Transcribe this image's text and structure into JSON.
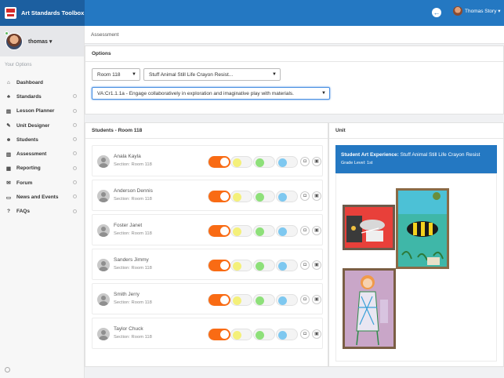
{
  "app": {
    "title": "Art Standards Toolbox"
  },
  "topbar": {
    "user_name": "Thomas Story",
    "user_caret": "▾",
    "back_glyph": "←"
  },
  "sidebar": {
    "profile_name": "thomas ▾",
    "section_label": "Your Options",
    "items": [
      {
        "label": "Dashboard",
        "icon": "⌂"
      },
      {
        "label": "Standards",
        "icon": "♣"
      },
      {
        "label": "Lesson Planner",
        "icon": "▤"
      },
      {
        "label": "Unit Designer",
        "icon": "✎"
      },
      {
        "label": "Students",
        "icon": "☻"
      },
      {
        "label": "Assessment",
        "icon": "▥"
      },
      {
        "label": "Reporting",
        "icon": "▦"
      },
      {
        "label": "Forum",
        "icon": "✉"
      },
      {
        "label": "News and Events",
        "icon": "▭"
      },
      {
        "label": "FAQs",
        "icon": "?"
      }
    ]
  },
  "breadcrumb": "Assessment",
  "options": {
    "heading": "Options",
    "room": "Room 118",
    "lesson": "Stuff Animal Still Life Crayon Resist...",
    "standard": "VA:Cr1.1.1a - Engage collaboratively in exploration and imaginative play with materials."
  },
  "students": {
    "heading": "Students - Room 118",
    "list": [
      {
        "name": "Anala Kayla",
        "section": "Section: Room 118"
      },
      {
        "name": "Anderson Dennis",
        "section": "Section: Room 118"
      },
      {
        "name": "Foster Janet",
        "section": "Section: Room 118"
      },
      {
        "name": "Sanders Jimmy",
        "section": "Section: Room 118"
      },
      {
        "name": "Smith Jerry",
        "section": "Section: Room 118"
      },
      {
        "name": "Taylor Chuck",
        "section": "Section: Room 118"
      }
    ],
    "rating_colors": [
      "#f96b14",
      "#f4f07a",
      "#8ee07a",
      "#7ec8f0"
    ],
    "camera_glyph": "◘",
    "save_glyph": "▣"
  },
  "unit": {
    "heading": "Unit",
    "experience_label": "Student Art Experience:",
    "experience_value": "Stuff Animal Still Life Crayon Resist",
    "grade": "Grade Level: 1st"
  }
}
